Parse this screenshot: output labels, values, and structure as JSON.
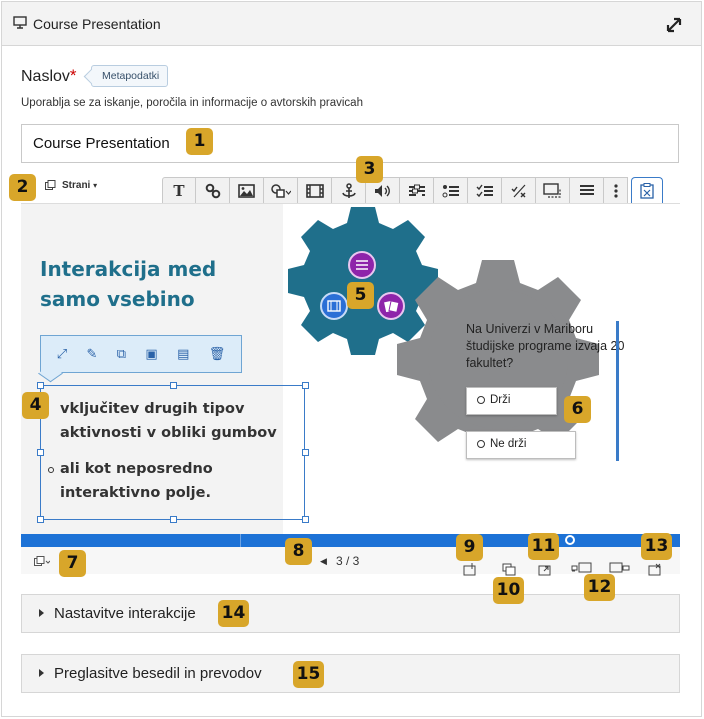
{
  "header": {
    "title": "Course Presentation",
    "icons": {
      "left": "monitor-icon",
      "right": "expand-icon"
    }
  },
  "field": {
    "label": "Naslov",
    "required_mark": "*",
    "metadata_button": "Metapodatki",
    "description": "Uporablja se za iskanje, poročila in informacije o avtorskih pravicah",
    "value": "Course Presentation"
  },
  "pages_dropdown": {
    "label": "Strani",
    "icon": "pages-icon"
  },
  "toolbar": {
    "icons": [
      "text-icon",
      "link-icon",
      "image-icon",
      "shapes-icon",
      "video-icon",
      "anchor-icon",
      "audio-icon",
      "fill-blanks-icon",
      "single-choice-icon",
      "multiple-choice-icon",
      "true-false-icon",
      "summary-icon",
      "more-options-icon",
      "paste-icon"
    ]
  },
  "slide": {
    "title": "Interakcija med samo vsebino",
    "element_toolbar_icons": [
      "resize-icon",
      "edit-icon",
      "copy-icon",
      "bring-front-icon",
      "send-back-icon",
      "delete-icon"
    ],
    "list_items": [
      "vključitev drugih tipov aktivnosti v obliki gumbov",
      "ali kot neposredno interaktivno polje."
    ],
    "quiz": {
      "question": "Na Univerzi v Mariboru študijske programe izvaja 20 fakultet?",
      "options": [
        "Drži",
        "Ne drži"
      ]
    },
    "colors": {
      "gear_left": "#1f6f8b",
      "gear_right": "#8a8b8d",
      "accent": "#1d72d6",
      "icon_purple": "#8e24aa",
      "icon_blue": "#2b6fd6"
    }
  },
  "footer": {
    "page_counter": "3 / 3",
    "icons": [
      "add-slide-icon",
      "clone-slide-icon",
      "import-slide-icon",
      "move-slide-left-icon",
      "move-slide-right-icon",
      "delete-slide-icon"
    ]
  },
  "badges": [
    "1",
    "2",
    "3",
    "4",
    "5",
    "6",
    "7",
    "8",
    "9",
    "10",
    "11",
    "12",
    "13",
    "14",
    "15"
  ],
  "accordions": [
    "Nastavitve interakcije",
    "Preglasitve besedil in prevodov"
  ]
}
